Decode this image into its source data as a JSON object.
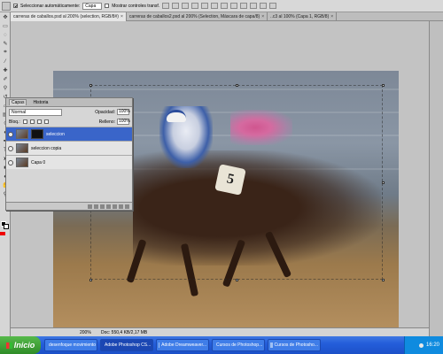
{
  "options_bar": {
    "auto_select_label": "Seleccionar automáticamente:",
    "auto_select_value": "Capa",
    "show_controls_label": "Mostrar controles transf."
  },
  "tabs": [
    {
      "label": "carreras de caballos.psd al 200% (selection, RGB/8#)"
    },
    {
      "label": "carreras de caballos2.psd al 200% (Selection, Máscara de capa/8)"
    },
    {
      "label": "..c3 al 100% (Capa 1, RGB/8)"
    }
  ],
  "layers_panel": {
    "tabs": [
      "Capas",
      "Historia"
    ],
    "blend_mode": "Normal",
    "opacity_label": "Opacidad:",
    "opacity_value": "100%",
    "lock_label": "Bloq.:",
    "fill_label": "Relleno:",
    "fill_value": "100%",
    "layers": [
      {
        "name": "seleccion",
        "active": true
      },
      {
        "name": "seleccion copia",
        "active": false
      },
      {
        "name": "Capa 0",
        "active": false
      }
    ]
  },
  "image": {
    "saddle_cloth_number": "5"
  },
  "status_bar": {
    "zoom": "200%",
    "doc_info": "Doc: 550,4 KB/2,17 MB"
  },
  "taskbar": {
    "start_label": "Inicio",
    "tasks": [
      {
        "label": "desenfoque movimiento"
      },
      {
        "label": "Adobe Photoshop CS..."
      },
      {
        "label": "Adobe Dreamweaver..."
      },
      {
        "label": "Cursos de Photoshop..."
      },
      {
        "label": "Cursos de Photosho..."
      }
    ],
    "clock": "16:20"
  },
  "colors": {
    "active_layer": "#3a65c9",
    "taskbar": "#245edb",
    "start_button": "#3c9a33"
  }
}
